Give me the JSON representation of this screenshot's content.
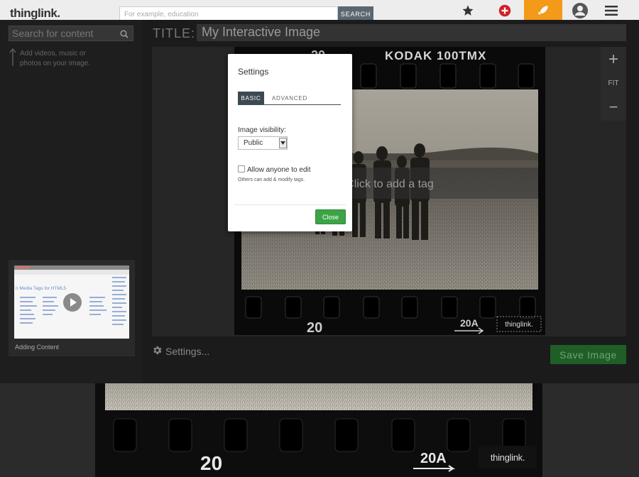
{
  "nav": {
    "logo": "thinglink.",
    "search_placeholder": "For example, education",
    "search_button": "SEARCH",
    "icons": [
      "star-icon",
      "plus-circle-icon",
      "rocket-icon",
      "user-avatar-icon",
      "hamburger-menu-icon"
    ],
    "accent_color": "#f39a1a"
  },
  "left_panel": {
    "search_placeholder": "Search for content",
    "hint": "Add videos, music or photos on your image.",
    "video": {
      "thumb_heading": "n Media Tags for HTML5",
      "title": "Adding Content"
    }
  },
  "editor": {
    "title_label": "TITLE:",
    "title_value": "My Interactive Image",
    "image_overlay_text": "Click to add a tag",
    "film_label": "KODAK  100TMX",
    "film_frame_top": "20",
    "film_frame_bottom_left": "20",
    "film_frame_bottom_right": "20A",
    "watermark": "thinglink.",
    "zoom": {
      "in": "+",
      "fit": "FIT",
      "out": "−"
    },
    "settings_link": "Settings...",
    "save_button": "Save Image",
    "save_color": "#1f5e27"
  },
  "modal": {
    "title": "Settings",
    "tabs": [
      {
        "label": "BASIC",
        "active": true
      },
      {
        "label": "ADVANCED",
        "active": false
      }
    ],
    "visibility_label": "Image visibility:",
    "visibility_value": "Public",
    "allow_edit_label": "Allow anyone to edit",
    "allow_edit_hint": "Others can add & modify tags.",
    "close_button": "Close",
    "close_color": "#3ca446"
  },
  "background": {
    "frame_left": "20",
    "frame_right": "20A",
    "watermark": "thinglink."
  }
}
